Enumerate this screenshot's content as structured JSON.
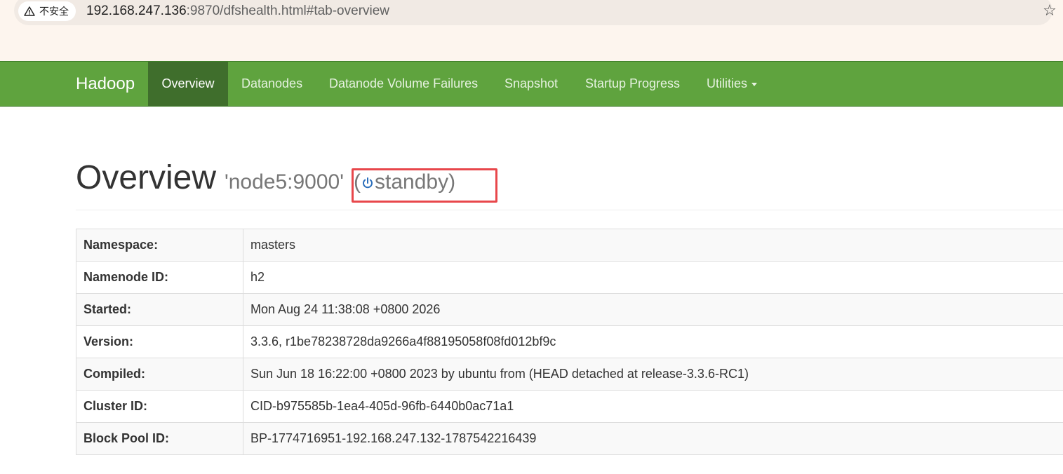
{
  "browser": {
    "security_label": "不安全",
    "url_host": "192.168.247.136",
    "url_rest": ":9870/dfshealth.html#tab-overview",
    "bookmark_icon": "star-icon"
  },
  "navbar": {
    "brand": "Hadoop",
    "items": [
      {
        "label": "Overview",
        "active": true
      },
      {
        "label": "Datanodes",
        "active": false
      },
      {
        "label": "Datanode Volume Failures",
        "active": false
      },
      {
        "label": "Snapshot",
        "active": false
      },
      {
        "label": "Startup Progress",
        "active": false
      },
      {
        "label": "Utilities",
        "active": false,
        "dropdown": true
      }
    ],
    "color": "#5fa33e",
    "active_color": "#3f6e2c"
  },
  "header": {
    "title": "Overview",
    "host": "'node5:9000'",
    "state_open": "(",
    "state": "standby)",
    "state_icon": "power-icon",
    "highlight_color": "#e8474b"
  },
  "summary": [
    {
      "key": "Namespace:",
      "value": "masters"
    },
    {
      "key": "Namenode ID:",
      "value": "h2"
    },
    {
      "key": "Started:",
      "value": "Mon Aug 24 11:38:08 +0800 2026"
    },
    {
      "key": "Version:",
      "value": "3.3.6, r1be78238728da9266a4f88195058f08fd012bf9c"
    },
    {
      "key": "Compiled:",
      "value": "Sun Jun 18 16:22:00 +0800 2023 by ubuntu from (HEAD detached at release-3.3.6-RC1)"
    },
    {
      "key": "Cluster ID:",
      "value": "CID-b975585b-1ea4-405d-96fb-6440b0ac71a1"
    },
    {
      "key": "Block Pool ID:",
      "value": "BP-1774716951-192.168.247.132-1787542216439"
    }
  ]
}
